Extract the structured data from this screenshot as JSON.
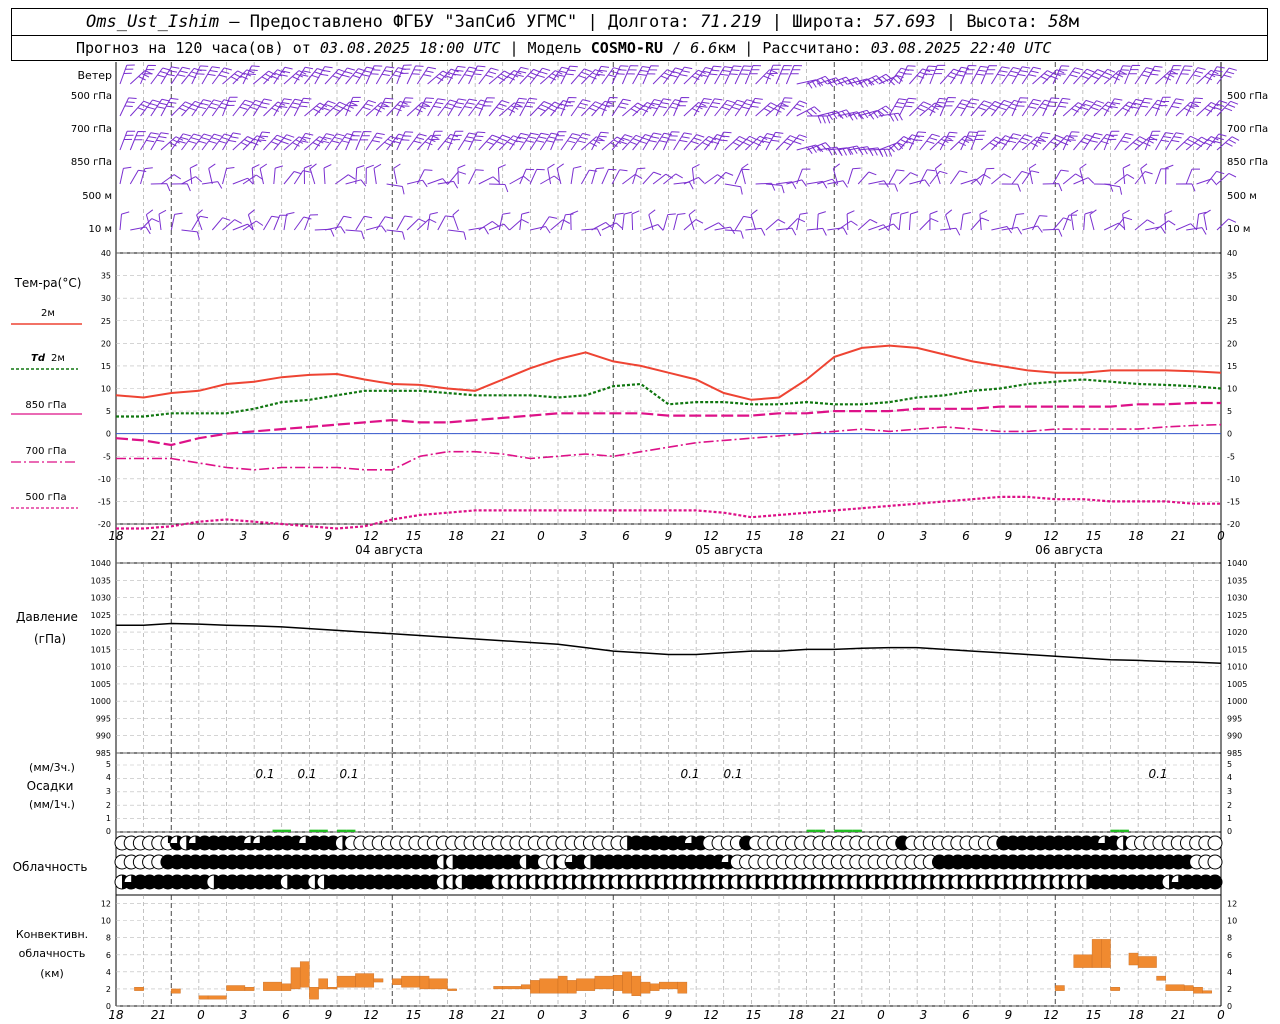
{
  "header": {
    "station": "Oms_Ust_Ishim",
    "dash": " – ",
    "provided_by": "Предоставлено ФГБУ \"ЗапСиб УГМС\"",
    "sep": " | ",
    "lon_label": "Долгота: ",
    "lon_value": "71.219",
    "lat_label": "Широта: ",
    "lat_value": "57.693",
    "alt_label": "Высота: ",
    "alt_value": "58",
    "alt_unit": "м",
    "forecast_prefix": "Прогноз на 120 часа(ов) от ",
    "forecast_from": "03.08.2025 18:00 UTC",
    "model_prefix": "  | Модель ",
    "model_name": "COSMO-RU",
    "model_slash": " / ",
    "model_res": "6.6",
    "model_res_unit": "км",
    "calc_prefix": " | Рассчитано: ",
    "calc_time": "03.08.2025 22:40 UTC"
  },
  "panels": {
    "wind": {
      "title": "Ветер",
      "levels": [
        "500 гПа",
        "700 гПа",
        "850 гПа",
        "500 м",
        "10 м"
      ]
    },
    "temperature": {
      "title": "Тем-ра(°С)",
      "legend": [
        {
          "label": "2м",
          "style": "solid",
          "color": "#ee4433"
        },
        {
          "label_italic": "Td",
          "label": "2м",
          "style": "dotted",
          "color": "#117711"
        },
        {
          "label": "850 гПа",
          "style": "dashed",
          "color": "#dd1188"
        },
        {
          "label": "700 гПа",
          "style": "dashdot",
          "color": "#dd1188"
        },
        {
          "label": "500 гПа",
          "style": "dotted",
          "color": "#dd1188"
        }
      ],
      "yticks": [
        "40",
        "35",
        "30",
        "25",
        "20",
        "15",
        "10",
        "5",
        "0",
        "-5",
        "-10",
        "-15",
        "-20"
      ]
    },
    "pressure": {
      "title": "Давление",
      "unit": "(гПа)",
      "yticks": [
        "1040",
        "1035",
        "1030",
        "1025",
        "1020",
        "1015",
        "1010",
        "1005",
        "1000",
        "995",
        "990",
        "985"
      ]
    },
    "precip": {
      "unit_top": "(мм/3ч.)",
      "title": "Осадки",
      "unit_bottom": "(мм/1ч.)",
      "ytick_labels": [
        "5",
        "4",
        "3",
        "2",
        "1",
        "0"
      ],
      "yticks_right": [
        "5",
        "4",
        "3",
        "2",
        "1",
        "0"
      ],
      "annotations": [
        "0.1",
        "0.1",
        "0.1",
        "0.1",
        "0.1",
        "0.1"
      ]
    },
    "clouds": {
      "title": "Облачность"
    },
    "convective": {
      "title_l1": "Конвективн.",
      "title_l2": "облачность",
      "title_l3": "(км)",
      "yticks": [
        "12",
        "10",
        "8",
        "6",
        "4",
        "2",
        "0"
      ]
    }
  },
  "time_axis": {
    "hour_labels": [
      "18",
      "21",
      "0",
      "3",
      "6",
      "9",
      "12",
      "15",
      "18",
      "21",
      "0",
      "3",
      "6",
      "9",
      "12",
      "15",
      "18",
      "21",
      "0",
      "3",
      "6",
      "9",
      "12",
      "15",
      "18",
      "21",
      "0"
    ],
    "date_labels": [
      "04 августа",
      "05 августа",
      "06 августа"
    ]
  },
  "chart_data": [
    {
      "type": "line",
      "title": "Тем-ра(°С)",
      "x_unit": "hours since 03.08.2025 18:00 UTC",
      "ylim": [
        -20,
        40
      ],
      "grid": true,
      "series": [
        {
          "name": "2м",
          "color": "#ee4433",
          "x": [
            0,
            3,
            6,
            9,
            12,
            15,
            18,
            21,
            24,
            27,
            30,
            33,
            36,
            39,
            42,
            45,
            48,
            51,
            54,
            57,
            60,
            63,
            66,
            69,
            72,
            75,
            78,
            81,
            84,
            87,
            90,
            93,
            96,
            99,
            102,
            105,
            108,
            111,
            114,
            117,
            120
          ],
          "values": [
            8.5,
            8,
            9,
            9.5,
            11,
            11.5,
            12.5,
            13,
            13.2,
            12,
            11,
            10.8,
            10,
            9.5,
            12,
            14.5,
            16.5,
            18,
            16,
            15,
            13.5,
            12,
            9,
            7.5,
            8,
            12,
            17,
            19,
            19.5,
            19,
            17.5,
            16,
            15,
            14,
            13.5,
            13.5,
            14,
            14,
            14,
            13.8,
            13.5
          ]
        },
        {
          "name": "Td 2м",
          "color": "#117711",
          "x": [
            0,
            3,
            6,
            9,
            12,
            15,
            18,
            21,
            24,
            27,
            30,
            33,
            36,
            39,
            42,
            45,
            48,
            51,
            54,
            57,
            60,
            63,
            66,
            69,
            72,
            75,
            78,
            81,
            84,
            87,
            90,
            93,
            96,
            99,
            102,
            105,
            108,
            111,
            114,
            117,
            120
          ],
          "values": [
            3.8,
            3.8,
            4.5,
            4.5,
            4.5,
            5.5,
            7,
            7.5,
            8.5,
            9.5,
            9.5,
            9.5,
            9,
            8.5,
            8.5,
            8.5,
            8,
            8.5,
            10.5,
            11,
            6.5,
            7,
            7,
            6.5,
            6.5,
            7,
            6.5,
            6.5,
            7,
            8,
            8.5,
            9.5,
            10,
            11,
            11.5,
            12,
            11.5,
            11,
            10.8,
            10.5,
            10
          ]
        },
        {
          "name": "850 гПа",
          "color": "#dd1188",
          "x": [
            0,
            3,
            6,
            9,
            12,
            15,
            18,
            21,
            24,
            27,
            30,
            33,
            36,
            39,
            42,
            45,
            48,
            51,
            54,
            57,
            60,
            63,
            66,
            69,
            72,
            75,
            78,
            81,
            84,
            87,
            90,
            93,
            96,
            99,
            102,
            105,
            108,
            111,
            114,
            117,
            120
          ],
          "values": [
            -1,
            -1.5,
            -2.5,
            -1,
            0,
            0.5,
            1,
            1.5,
            2,
            2.5,
            3,
            2.5,
            2.5,
            3,
            3.5,
            4,
            4.5,
            4.5,
            4.5,
            4.5,
            4,
            4,
            4,
            4,
            4.5,
            4.5,
            5,
            5,
            5,
            5.5,
            5.5,
            5.5,
            6,
            6,
            6,
            6,
            6,
            6.5,
            6.5,
            6.8,
            6.8
          ]
        },
        {
          "name": "700 гПа",
          "color": "#dd1188",
          "x": [
            0,
            3,
            6,
            9,
            12,
            15,
            18,
            21,
            24,
            27,
            30,
            33,
            36,
            39,
            42,
            45,
            48,
            51,
            54,
            57,
            60,
            63,
            66,
            69,
            72,
            75,
            78,
            81,
            84,
            87,
            90,
            93,
            96,
            99,
            102,
            105,
            108,
            111,
            114,
            117,
            120
          ],
          "values": [
            -5.5,
            -5.5,
            -5.5,
            -6.5,
            -7.5,
            -8,
            -7.5,
            -7.5,
            -7.5,
            -8,
            -8,
            -5,
            -4,
            -4,
            -4.5,
            -5.5,
            -5,
            -4.5,
            -5,
            -4,
            -3,
            -2,
            -1.5,
            -1,
            -0.5,
            0,
            0.5,
            1,
            0.5,
            1,
            1.5,
            1,
            0.5,
            0.5,
            1,
            1,
            1,
            1,
            1.5,
            1.8,
            2
          ]
        },
        {
          "name": "500 гПа",
          "color": "#dd1188",
          "x": [
            0,
            3,
            6,
            9,
            12,
            15,
            18,
            21,
            24,
            27,
            30,
            33,
            36,
            39,
            42,
            45,
            48,
            51,
            54,
            57,
            60,
            63,
            66,
            69,
            72,
            75,
            78,
            81,
            84,
            87,
            90,
            93,
            96,
            99,
            102,
            105,
            108,
            111,
            114,
            117,
            120
          ],
          "values": [
            -21,
            -21,
            -20.5,
            -19.5,
            -19,
            -19.5,
            -20,
            -20.5,
            -21,
            -20.5,
            -19,
            -18,
            -17.5,
            -17,
            -17,
            -17,
            -17,
            -17,
            -17,
            -17,
            -17,
            -17,
            -17.5,
            -18.5,
            -18,
            -17.5,
            -17,
            -16.5,
            -16,
            -15.5,
            -15,
            -14.5,
            -14,
            -14,
            -14.5,
            -14.5,
            -15,
            -15,
            -15,
            -15.5,
            -15.5
          ]
        }
      ]
    },
    {
      "type": "line",
      "title": "Давление",
      "x_unit": "hours since 03.08.2025 18:00 UTC",
      "ylim": [
        985,
        1040
      ],
      "grid": true,
      "series": [
        {
          "name": "Давление",
          "color": "#000000",
          "x": [
            0,
            3,
            6,
            9,
            12,
            15,
            18,
            21,
            24,
            27,
            30,
            33,
            36,
            39,
            42,
            45,
            48,
            51,
            54,
            57,
            60,
            63,
            66,
            69,
            72,
            75,
            78,
            81,
            84,
            87,
            90,
            93,
            96,
            99,
            102,
            105,
            108,
            111,
            114,
            117,
            120
          ],
          "values": [
            1022,
            1022,
            1022.5,
            1022.3,
            1022,
            1021.8,
            1021.5,
            1021,
            1020.5,
            1020,
            1019.5,
            1019,
            1018.5,
            1018,
            1017.5,
            1017,
            1016.5,
            1015.5,
            1014.5,
            1014,
            1013.5,
            1013.5,
            1014,
            1014.5,
            1014.5,
            1015,
            1015,
            1015.3,
            1015.5,
            1015.5,
            1015,
            1014.5,
            1014,
            1013.5,
            1013,
            1012.5,
            1012,
            1011.8,
            1011.5,
            1011.3,
            1011
          ]
        }
      ]
    },
    {
      "type": "bar",
      "title": "Осадки",
      "x_unit": "hours since 03.08.2025 18:00 UTC",
      "ylim": [
        0,
        5
      ],
      "grid": true,
      "series": [
        {
          "name": "мм/1ч.",
          "color": "#22bb22",
          "x": [
            17,
            18,
            21,
            22,
            24,
            25,
            75,
            76,
            78,
            79,
            80,
            108,
            109
          ],
          "values": [
            0.1,
            0.1,
            0.1,
            0.1,
            0.1,
            0.1,
            0.1,
            0.1,
            0.1,
            0.1,
            0.1,
            0.1,
            0.1
          ]
        }
      ],
      "annotations": [
        {
          "x": 19.5,
          "label": "0.1"
        },
        {
          "x": 22.5,
          "label": "0.1"
        },
        {
          "x": 25.5,
          "label": "0.1"
        },
        {
          "x": 76.5,
          "label": "0.1"
        },
        {
          "x": 79.5,
          "label": "0.1"
        },
        {
          "x": 109.5,
          "label": "0.1"
        }
      ]
    },
    {
      "type": "bar",
      "title": "Конвективн. облачность (км)",
      "x_unit": "hours since 03.08.2025 18:00 UTC",
      "ylim": [
        0,
        13
      ],
      "grid": true,
      "series": [
        {
          "name": "Конвективн. облачность",
          "color": "#f08a30",
          "bars": [
            [
              2,
              3,
              1.8,
              2.2
            ],
            [
              6,
              7,
              1.5,
              2
            ],
            [
              9,
              10,
              0.8,
              1.2
            ],
            [
              10,
              12,
              0.8,
              1.2
            ],
            [
              12,
              14,
              1.8,
              2.4
            ],
            [
              14,
              15,
              1.8,
              2.2
            ],
            [
              16,
              18,
              1.8,
              2.8
            ],
            [
              18,
              19,
              1.8,
              2.6
            ],
            [
              19,
              20,
              2,
              4.5
            ],
            [
              20,
              21,
              2.2,
              5.2
            ],
            [
              21,
              22,
              0.8,
              2.2
            ],
            [
              22,
              23,
              2,
              3.2
            ],
            [
              23,
              24,
              2,
              2.2
            ],
            [
              24,
              26,
              2.2,
              3.5
            ],
            [
              26,
              28,
              2.2,
              3.8
            ],
            [
              28,
              29,
              2.8,
              3.2
            ],
            [
              30,
              31,
              2.5,
              3.2
            ],
            [
              31,
              33,
              2.2,
              3.5
            ],
            [
              33,
              34,
              2,
              3.5
            ],
            [
              34,
              36,
              2,
              3.2
            ],
            [
              36,
              37,
              1.8,
              2
            ],
            [
              41,
              42,
              2,
              2.3
            ],
            [
              42,
              44,
              2,
              2.3
            ],
            [
              44,
              45,
              2,
              2.5
            ],
            [
              45,
              46,
              1.5,
              3
            ],
            [
              46,
              48,
              1.5,
              3.2
            ],
            [
              48,
              49,
              1.5,
              3.5
            ],
            [
              49,
              50,
              1.5,
              3
            ],
            [
              50,
              52,
              1.8,
              3.2
            ],
            [
              52,
              54,
              2,
              3.5
            ],
            [
              54,
              55,
              1.8,
              3.6
            ],
            [
              55,
              56,
              1.5,
              4
            ],
            [
              56,
              57,
              1.2,
              3.5
            ],
            [
              57,
              58,
              1.5,
              2.8
            ],
            [
              58,
              59,
              1.8,
              2.6
            ],
            [
              59,
              61,
              2,
              2.8
            ],
            [
              61,
              62,
              1.5,
              2.8
            ],
            [
              102,
              103,
              1.8,
              2.4
            ],
            [
              104,
              106,
              4.5,
              6
            ],
            [
              106,
              107,
              4.5,
              7.8
            ],
            [
              107,
              108,
              4.5,
              7.8
            ],
            [
              108,
              109,
              1.8,
              2.2
            ],
            [
              110,
              111,
              4.8,
              6.2
            ],
            [
              111,
              113,
              4.5,
              5.8
            ],
            [
              113,
              114,
              3,
              3.5
            ],
            [
              114,
              116,
              1.8,
              2.5
            ],
            [
              116,
              117,
              1.8,
              2.4
            ],
            [
              117,
              118,
              1.5,
              2.2
            ],
            [
              118,
              119,
              1.5,
              1.8
            ]
          ]
        }
      ]
    }
  ]
}
